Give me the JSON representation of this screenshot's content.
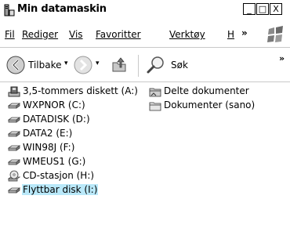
{
  "window": {
    "title": "Min datamaskin",
    "controls": {
      "minimize": "_",
      "maximize": "□",
      "close": "X"
    }
  },
  "menu": {
    "items": [
      {
        "id": "fil",
        "label": "Fil"
      },
      {
        "id": "rediger",
        "label": "Rediger"
      },
      {
        "id": "vis",
        "label": "Vis"
      },
      {
        "id": "favoritter",
        "label": "Favoritter"
      },
      {
        "id": "verktoy",
        "label": "Verktøy"
      },
      {
        "id": "hjelp",
        "label": "H"
      }
    ],
    "overflow": "»"
  },
  "toolbar": {
    "back_label": "Tilbake",
    "caret": "▾",
    "search_label": "Søk",
    "overflow": "»"
  },
  "items_left": [
    {
      "label": "3,5-tommers diskett (A:)",
      "icon": "floppy-drive-icon"
    },
    {
      "label": "WXPNOR (C:)",
      "icon": "hard-drive-icon"
    },
    {
      "label": "DATADISK (D:)",
      "icon": "hard-drive-icon"
    },
    {
      "label": "DATA2 (E:)",
      "icon": "hard-drive-icon"
    },
    {
      "label": "WIN98J (F:)",
      "icon": "hard-drive-icon"
    },
    {
      "label": "WMEUS1 (G:)",
      "icon": "hard-drive-icon"
    },
    {
      "label": "CD-stasjon (H:)",
      "icon": "cd-drive-icon"
    },
    {
      "label": "Flyttbar disk (I:)",
      "icon": "removable-drive-icon",
      "selected": true
    }
  ],
  "items_right": [
    {
      "label": "Delte dokumenter",
      "icon": "shared-folder-icon"
    },
    {
      "label": "Dokumenter (sano)",
      "icon": "folder-icon"
    }
  ],
  "colors": {
    "selection": "#b9e8f9"
  }
}
